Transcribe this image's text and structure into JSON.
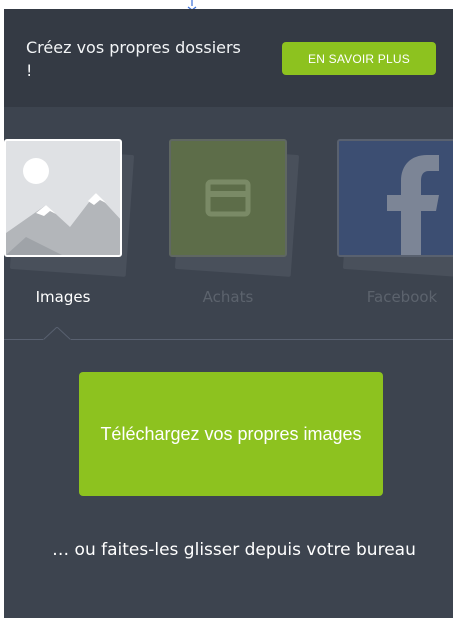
{
  "promo": {
    "text": "Créez vos propres dossiers !",
    "button_label": "EN SAVOIR PLUS"
  },
  "folders": [
    {
      "label": "Images",
      "selected": true,
      "icon": "image-placeholder-icon"
    },
    {
      "label": "Achats",
      "selected": false,
      "icon": "card-icon"
    },
    {
      "label": "Facebook",
      "selected": false,
      "icon": "facebook-icon"
    }
  ],
  "upload": {
    "button_label": "Téléchargez vos propres images",
    "hint": "… ou faites-les glisser depuis votre bureau"
  },
  "colors": {
    "accent": "#8dc21f",
    "panel": "#3d444f",
    "promo_bar": "#343a44"
  }
}
